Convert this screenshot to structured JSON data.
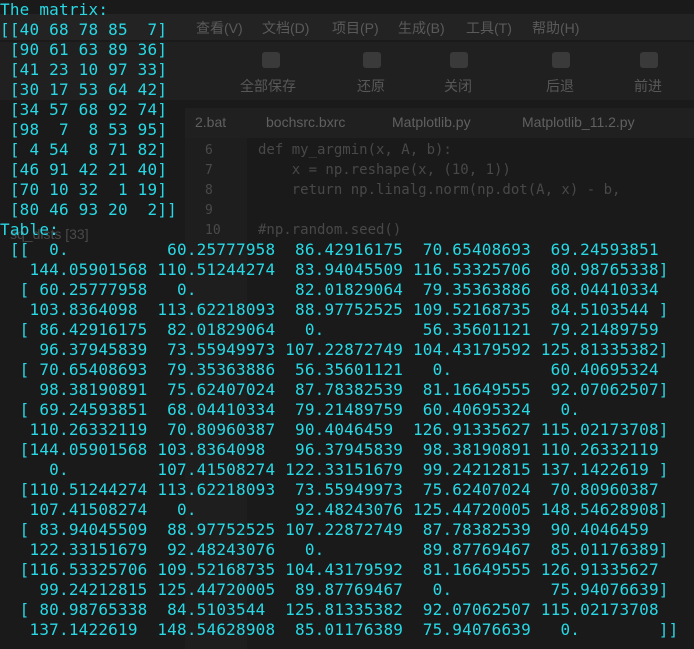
{
  "background_editor": {
    "menu": [
      "查看(V)",
      "文档(D)",
      "项目(P)",
      "生成(B)",
      "工具(T)",
      "帮助(H)"
    ],
    "toolbar": [
      "全部保存",
      "还原",
      "关闭",
      "后退",
      "前进"
    ],
    "tabs": [
      "2.bat",
      "bochsrc.bxrc",
      "Matplotlib.py",
      "Matplotlib_11.2.py"
    ],
    "line_numbers": [
      "6",
      "7",
      "8",
      "9",
      "10"
    ],
    "code": [
      "def my_argmin(x, A, b):",
      "    x = np.reshape(x, (10, 1))",
      "    return np.linalg.norm(np.dot(A, x) - b,",
      "",
      "#np.random.seed()"
    ],
    "sidebar": [
      "sq_dists [33]"
    ]
  },
  "console": {
    "lines": [
      "The matrix:",
      "[[40 68 78 85  7]",
      " [90 61 63 89 36]",
      " [41 23 10 97 33]",
      " [30 17 53 64 42]",
      " [34 57 68 92 74]",
      " [98  7  8 53 95]",
      " [ 4 54  8 71 82]",
      " [46 91 42 21 40]",
      " [70 10 32  1 19]",
      " [80 46 93 20  2]]",
      "Table:",
      " [[  0.          60.25777958  86.42916175  70.65408693  69.24593851",
      "   144.05901568 110.51244274  83.94045509 116.53325706  80.98765338]",
      "  [ 60.25777958   0.          82.01829064  79.35363886  68.04410334",
      "   103.8364098  113.62218093  88.97752525 109.52168735  84.5103544 ]",
      "  [ 86.42916175  82.01829064   0.          56.35601121  79.21489759",
      "    96.37945839  73.55949973 107.22872749 104.43179592 125.81335382]",
      "  [ 70.65408693  79.35363886  56.35601121   0.          60.40695324",
      "    98.38190891  75.62407024  87.78382539  81.16649555  92.07062507]",
      "  [ 69.24593851  68.04410334  79.21489759  60.40695324   0.",
      "   110.26332119  70.80960387  90.4046459  126.91335627 115.02173708]",
      "  [144.05901568 103.8364098   96.37945839  98.38190891 110.26332119",
      "     0.         107.41508274 122.33151679  99.24212815 137.1422619 ]",
      "  [110.51244274 113.62218093  73.55949973  75.62407024  70.80960387",
      "   107.41508274   0.          92.48243076 125.44720005 148.54628908]",
      "  [ 83.94045509  88.97752525 107.22872749  87.78382539  90.4046459",
      "   122.33151679  92.48243076   0.          89.87769467  85.01176389]",
      "  [116.53325706 109.52168735 104.43179592  81.16649555 126.91335627",
      "    99.24212815 125.44720005  89.87769467   0.          75.94076639]",
      "  [ 80.98765338  84.5103544  125.81335382  92.07062507 115.02173708",
      "   137.1422619  148.54628908  85.01176389  75.94076639   0.        ]]"
    ]
  },
  "colors": {
    "console_text": "#28d8e4",
    "background": "#1a1a1a"
  }
}
